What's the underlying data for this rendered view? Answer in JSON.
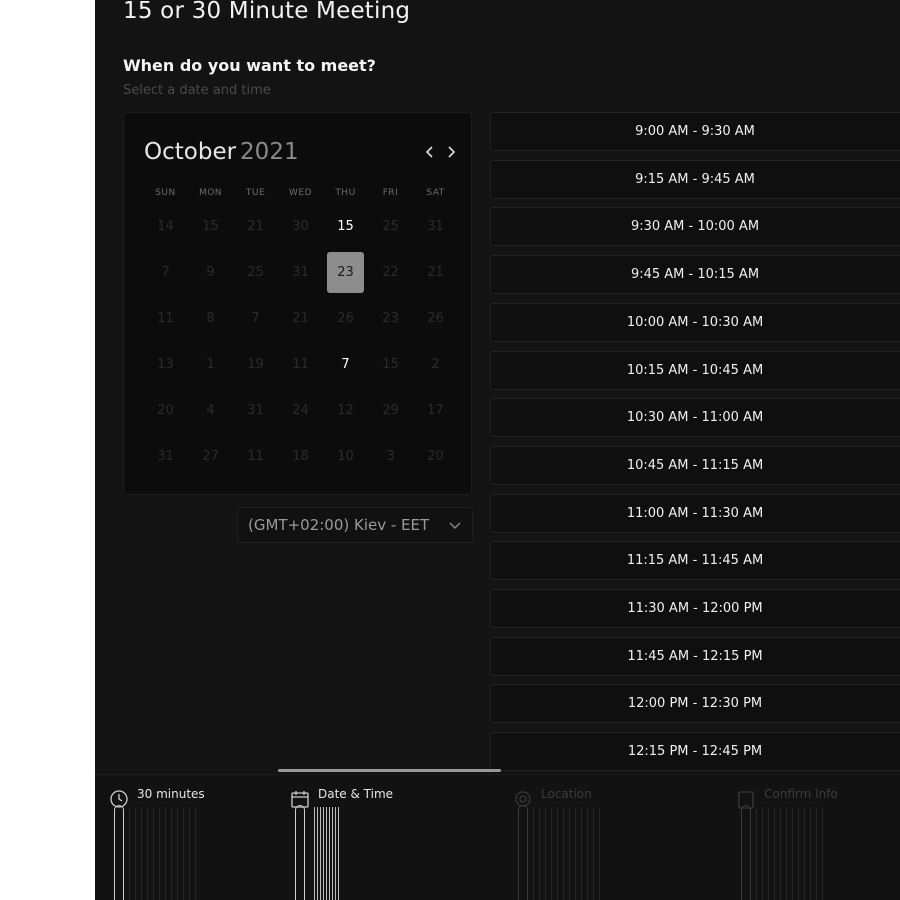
{
  "page": {
    "title": "15 or 30 Minute Meeting",
    "question": "When do you want to meet?",
    "subtitle": "Select a date and time"
  },
  "calendar": {
    "month": "October",
    "year": "2021",
    "weekdays": [
      "SUN",
      "MON",
      "TUE",
      "WED",
      "THU",
      "FRI",
      "SAT"
    ],
    "days": [
      "14",
      "15",
      "21",
      "30",
      "15",
      "25",
      "31",
      "7",
      "9",
      "25",
      "31",
      "23",
      "22",
      "21",
      "11",
      "8",
      "7",
      "21",
      "26",
      "23",
      "26",
      "13",
      "1",
      "19",
      "11",
      "7",
      "15",
      "2",
      "20",
      "4",
      "31",
      "24",
      "12",
      "29",
      "17",
      "31",
      "27",
      "11",
      "18",
      "10",
      "3",
      "20"
    ],
    "available_indices": [
      4,
      25
    ],
    "selected_index": 11
  },
  "timezone": {
    "label": "(GMT+02:00) Kiev - EET"
  },
  "time_slots": [
    "9:00 AM - 9:30 AM",
    "9:15 AM - 9:45 AM",
    "9:30 AM - 10:00 AM",
    "9:45 AM - 10:15 AM",
    "10:00 AM - 10:30 AM",
    "10:15 AM - 10:45 AM",
    "10:30 AM - 11:00 AM",
    "10:45 AM - 11:15 AM",
    "11:00 AM - 11:30 AM",
    "11:15 AM - 11:45 AM",
    "11:30 AM - 12:00 PM",
    "11:45 AM - 12:15 PM",
    "12:00 PM - 12:30 PM",
    "12:15 PM - 12:45 PM"
  ],
  "steps": [
    {
      "label": "30 minutes",
      "icon": "clock-icon",
      "state": "done"
    },
    {
      "label": "Date & Time",
      "icon": "calendar-icon",
      "state": "active"
    },
    {
      "label": "Location",
      "icon": "location-pin-icon",
      "state": "pending"
    },
    {
      "label": "Confirm Info",
      "icon": "clipboard-icon",
      "state": "pending"
    }
  ],
  "colors": {
    "background": "#131313",
    "selected_day": "#8d8d8d",
    "slot_border": "#232323"
  }
}
